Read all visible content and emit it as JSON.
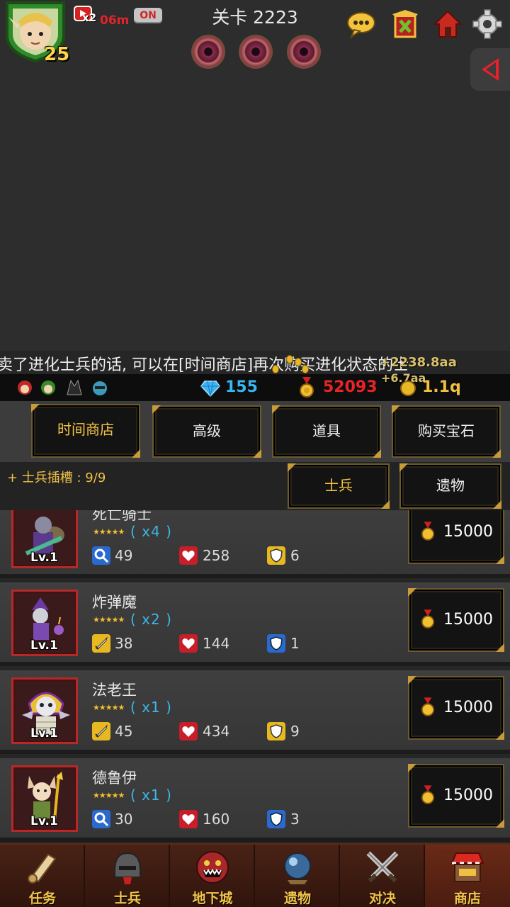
{
  "header": {
    "hero_level": "25",
    "video_multiplier": "x2",
    "video_timer": "06m",
    "toggle_label": "ON",
    "stage_title": "关卡 2223",
    "icons": [
      "chat-icon",
      "trophy-banner-icon",
      "home-icon",
      "settings-icon",
      "back-arrow-icon"
    ]
  },
  "ticker": {
    "message": "卖了进化士兵的话, 可以在[时间商店]再次购买进化状态的士",
    "float_text": "+2238.8aa",
    "float_text_2": "+6.7aa"
  },
  "resources": {
    "gems": "155",
    "medals": "52093",
    "gold": "1.1q",
    "colors": {
      "gems": "#38b6f0",
      "medals": "#e82424",
      "gold": "#f0c040"
    }
  },
  "shop_tabs": [
    {
      "label": "时间商店",
      "active": true
    },
    {
      "label": "高级",
      "active": false
    },
    {
      "label": "道具",
      "active": false
    },
    {
      "label": "购买宝石",
      "active": false
    }
  ],
  "sub_tabs": {
    "slot_text": "+ 士兵插槽 : 9/9",
    "soldier_label": "士兵",
    "relic_label": "遗物"
  },
  "units": [
    {
      "name": "死亡骑士",
      "count": "( x4 )",
      "level": "Lv.1",
      "attack": "49",
      "attack_icon": "magnifier-icon",
      "hp": "258",
      "armor": "6",
      "armor_type": "gold-shield-icon",
      "price": "15000"
    },
    {
      "name": "炸弹魔",
      "count": "( x2 )",
      "level": "Lv.1",
      "attack": "38",
      "attack_icon": "sword-icon",
      "hp": "144",
      "armor": "1",
      "armor_type": "blue-shield-icon",
      "price": "15000"
    },
    {
      "name": "法老王",
      "count": "( x1 )",
      "level": "Lv.1",
      "attack": "45",
      "attack_icon": "sword-icon",
      "hp": "434",
      "armor": "9",
      "armor_type": "gold-shield-icon",
      "price": "15000"
    },
    {
      "name": "德鲁伊",
      "count": "( x1 )",
      "level": "Lv.1",
      "attack": "30",
      "attack_icon": "magnifier-icon",
      "hp": "160",
      "armor": "3",
      "armor_type": "blue-shield-icon",
      "price": "15000"
    }
  ],
  "nav": [
    {
      "label": "任务",
      "icon": "scroll-icon",
      "active": false
    },
    {
      "label": "士兵",
      "icon": "helmet-icon",
      "active": false
    },
    {
      "label": "地下城",
      "icon": "monster-icon",
      "active": false
    },
    {
      "label": "遗物",
      "icon": "orb-icon",
      "active": false
    },
    {
      "label": "对决",
      "icon": "crossed-swords-icon",
      "active": false
    },
    {
      "label": "商店",
      "icon": "shop-icon",
      "active": true
    }
  ]
}
